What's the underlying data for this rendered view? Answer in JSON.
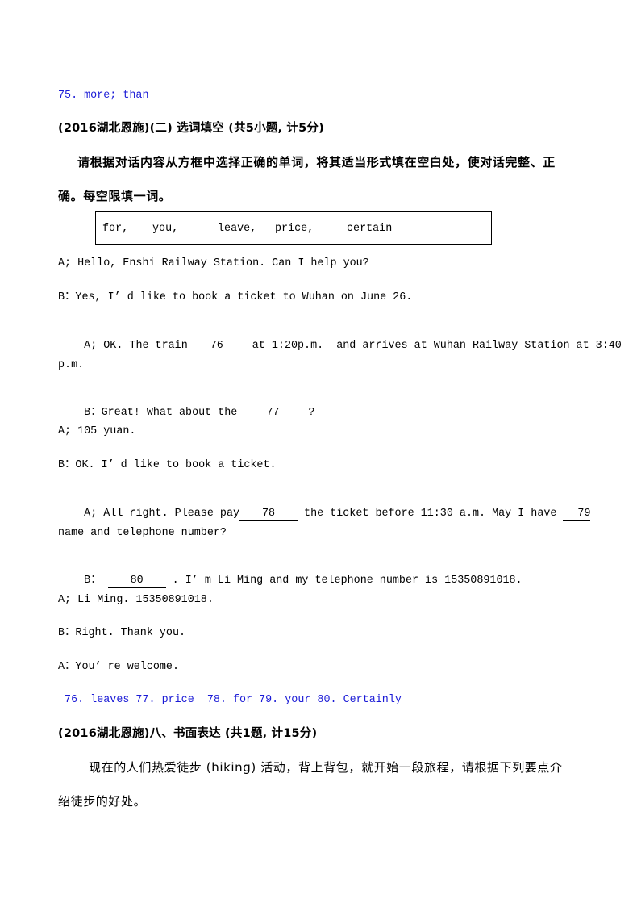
{
  "answer_prev": "75. more; than",
  "section1": {
    "heading": "(2016湖北恩施)(二) 选词填空 (共5小题, 计5分)",
    "instruction_line1": "请根据对话内容从方框中选择正确的单词，将其适当形式填在空白处，使对话完整、正",
    "instruction_line2": "确。每空限填一词。",
    "word_box": [
      "for,",
      "you,",
      "leave,",
      "price,",
      "certain"
    ]
  },
  "dialogue": {
    "l1": "A; Hello, Enshi Railway Station. Can I help you?",
    "l2": "B：Yes, I’ d like to book a ticket to Wuhan on June 26.",
    "l3_pre": "A; OK. The train",
    "blank76": "76",
    "l3_post": " at 1:20p.m.  and arrives at Wuhan Railway Station at 3:40",
    "l4": "p.m.",
    "l5_pre": "B：Great! What about the ",
    "blank77": "77",
    "l5_post": " ?",
    "l6": "A; 105 yuan.",
    "l7": "B：OK. I’ d like to book a ticket.",
    "l8_pre": "A; All right. Please pay",
    "blank78": "78",
    "l8_mid": " the ticket before 11:30 a.m. May I have ",
    "blank79": "79",
    "l9": "name and telephone number?",
    "l10_pre": "B： ",
    "blank80": "80",
    "l10_post": " . I’ m Li Ming and my telephone number is 15350891018.",
    "l11": "A; Li Ming. 15350891018.",
    "l12": "B：Right. Thank you.",
    "l13": "A：You’ re welcome."
  },
  "answers": " 76. leaves 77. price  78. for 79. your 80. Certainly",
  "section2": {
    "heading": "(2016湖北恩施)八、书面表达 (共1题, 计15分)",
    "prompt_line1": "现在的人们热爱徒步 (hiking) 活动，背上背包，就开始一段旅程，请根据下列要点介",
    "prompt_line2": "绍徒步的好处。"
  }
}
